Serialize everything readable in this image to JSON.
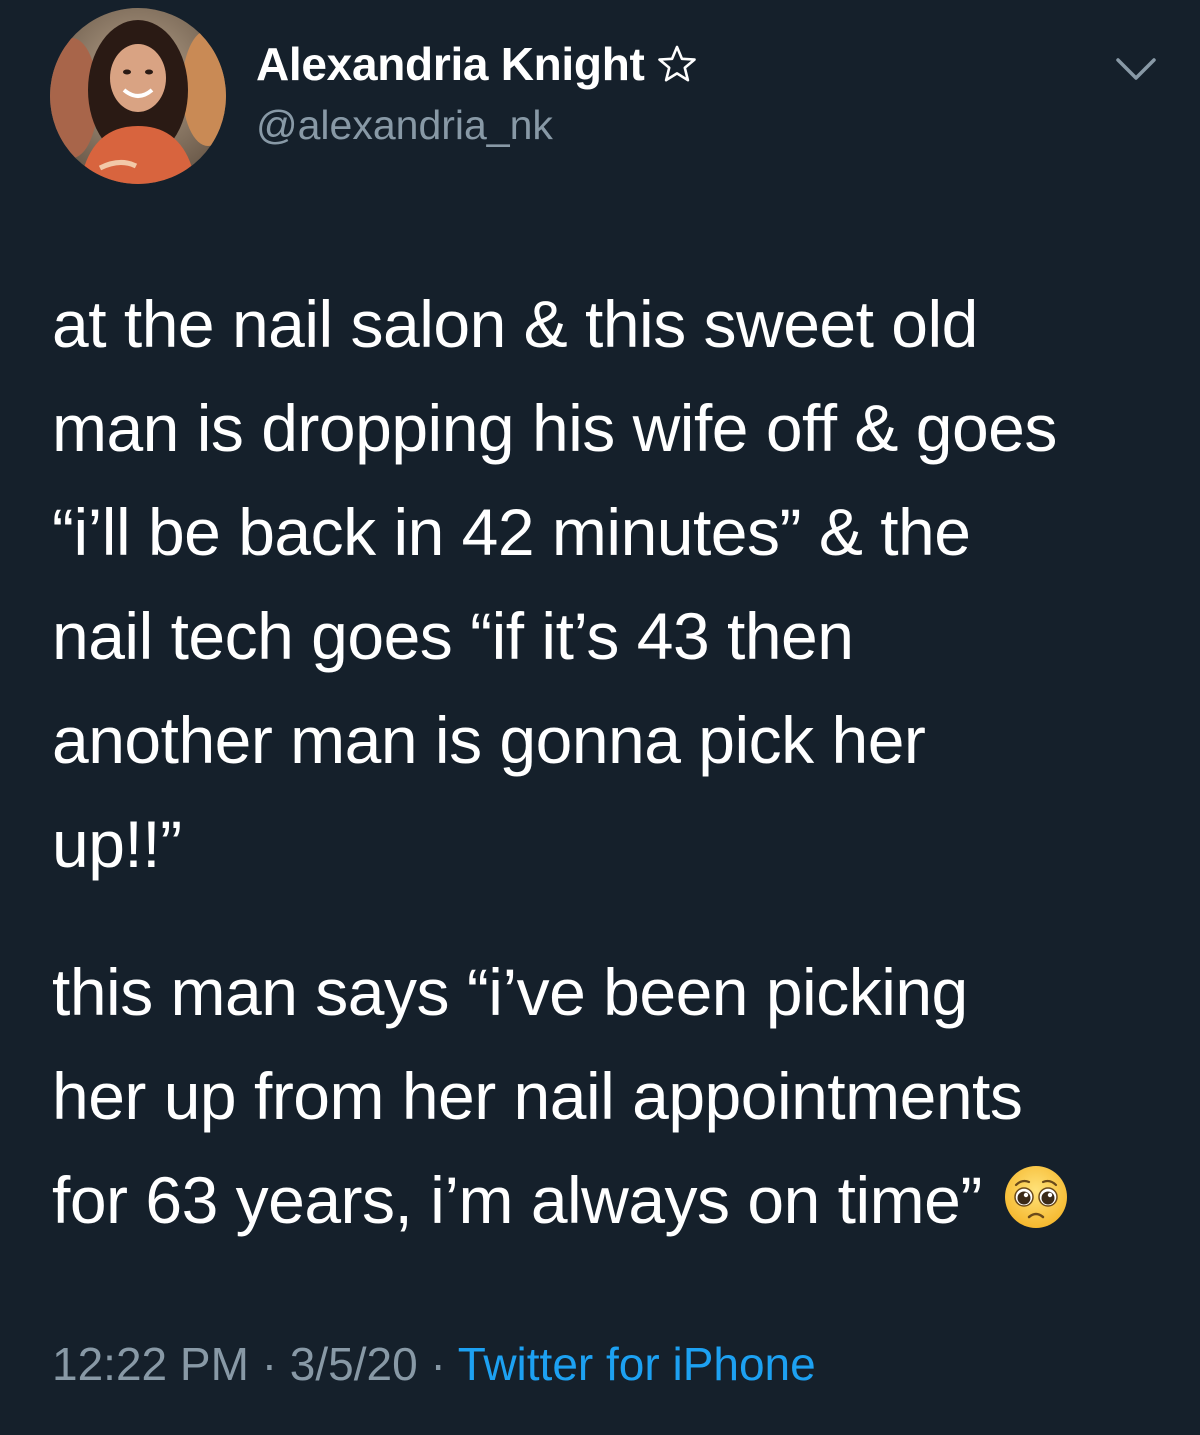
{
  "tweet": {
    "author": {
      "display_name": "Alexandria Knight",
      "handle": "@alexandria_nk",
      "name_badge_icon": "star-outline-icon",
      "avatar": "avatar-photo"
    },
    "menu_icon": "chevron-down-icon",
    "text_lines": [
      "at the nail salon & this sweet old",
      "man is dropping his wife off & goes",
      "“i’ll be back in 42 minutes” & the",
      "nail tech goes “if it’s 43 then",
      "another man is gonna pick her",
      "up!!”"
    ],
    "text_lines_2": [
      "this man says “i’ve been picking",
      "her up from her nail appointments",
      "for 63 years, i’m always on time”"
    ],
    "trailing_emoji": "pleading-face-emoji",
    "time": "12:22 PM",
    "separator": "·",
    "date": "3/5/20",
    "source": "Twitter for iPhone"
  },
  "colors": {
    "background": "#15202b",
    "text": "#ffffff",
    "secondary_text": "#8899a6",
    "link": "#1da1f2"
  }
}
